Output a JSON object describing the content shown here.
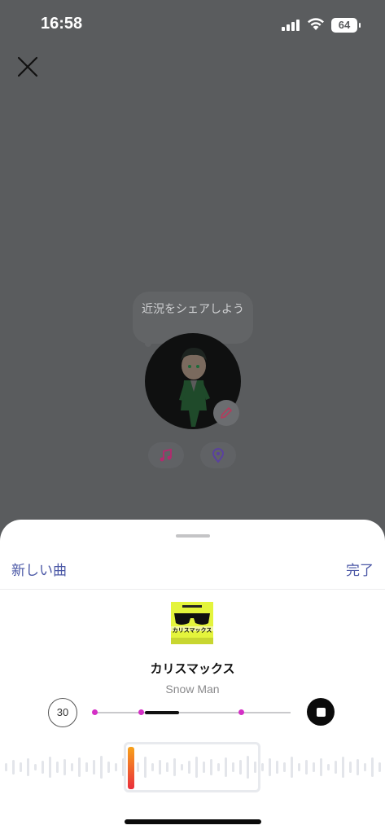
{
  "status_bar": {
    "time": "16:58",
    "battery": "64",
    "icons": [
      "cellular-signal-icon",
      "wifi-icon",
      "battery-icon"
    ]
  },
  "background_screen": {
    "close_icon": "close-icon",
    "bubble_text": "近況をシェアしよう",
    "buttons": [
      "music-note-icon",
      "location-pin-icon"
    ],
    "edit_icon": "pencil-icon"
  },
  "sheet": {
    "left_action": "新しい曲",
    "right_action": "完了",
    "song": {
      "title": "カリスマックス",
      "artist": "Snow Man",
      "album_art_text": "カリスマックス"
    },
    "duration": "30",
    "playback": {
      "state": "playing",
      "stop_icon": "stop-icon"
    }
  },
  "colors": {
    "accent": "#4b58a6",
    "marker": "#d42fc6",
    "handle_top": "#f7a21b",
    "handle_bottom": "#ea2d3c",
    "overlay": "#5a5c5e"
  }
}
